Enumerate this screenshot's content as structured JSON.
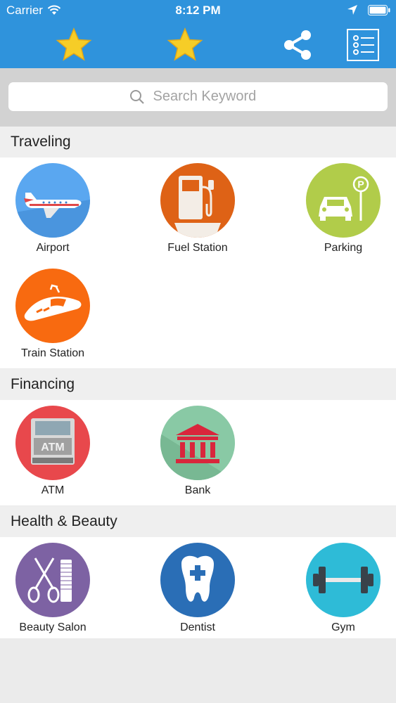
{
  "status_bar": {
    "carrier": "Carrier",
    "time": "8:12 PM"
  },
  "toolbar": {
    "icons": [
      "star-icon",
      "star-icon",
      "share-icon",
      "list-icon"
    ]
  },
  "search": {
    "placeholder": "Search Keyword"
  },
  "colors": {
    "header": "#2f93dc",
    "section_bg": "#efefef",
    "search_bg": "#d2d2d2"
  },
  "sections": [
    {
      "title": "Traveling",
      "items": [
        "Airport",
        "Fuel Station",
        "Parking",
        "Train Station"
      ]
    },
    {
      "title": "Financing",
      "items": [
        "ATM",
        "Bank"
      ]
    },
    {
      "title": "Health & Beauty",
      "items": [
        "Beauty Salon",
        "Dentist",
        "Gym"
      ]
    }
  ],
  "atm_text": "ATM",
  "parking_sign": "P"
}
